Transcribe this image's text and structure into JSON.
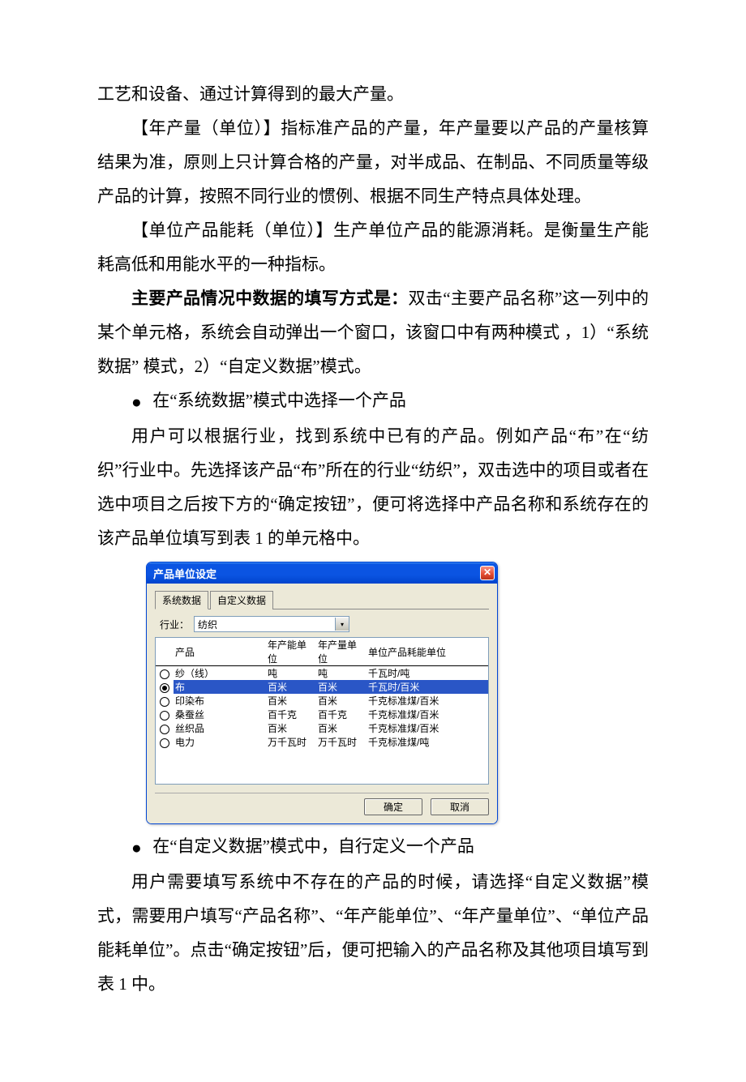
{
  "paragraphs": {
    "p1_text": "工艺和设备、通过计算得到的最大产量。",
    "p2_label": "【年产量（单位）】",
    "p2_text": "指标准产品的产量，年产量要以产品的产量核算结果为准，原则上只计算合格的产量，对半成品、在制品、不同质量等级产品的计算，按照不同行业的惯例、根据不同生产特点具体处理。",
    "p3_label": "【单位产品能耗（单位）】",
    "p3_text": "生产单位产品的能源消耗。是衡量生产能耗高低和用能水平的一种指标。",
    "p4_label": "主要产品情况中数据的填写方式是：",
    "p4_text": "双击“主要产品名称”这一列中的某个单元格，系统会自动弹出一个窗口，该窗口中有两种模式 ，1）“系统数据” 模式，2）“自定义数据”模式。",
    "bullet1_text": "在“系统数据”模式中选择一个产品",
    "p5_text": "用户可以根据行业，找到系统中已有的产品。例如产品“布”在“纺织”行业中。先选择该产品“布”所在的行业“纺织”，双击选中的项目或者在选中项目之后按下方的“确定按钮”，便可将选择中产品名称和系统存在的该产品单位填写到表 1 的单元格中。",
    "bullet2_text": "在“自定义数据”模式中，自行定义一个产品",
    "p6_text": "用户需要填写系统中不存在的产品的时候，请选择“自定义数据”模式，需要用户填写“产品名称”、“年产能单位”、“年产量单位”、“单位产品能耗单位”。点击“确定按钮”后，便可把输入的产品名称及其他项目填写到表 1 中。"
  },
  "dialog": {
    "title": "产品单位设定",
    "tabs": {
      "system": "系统数据",
      "custom": "自定义数据"
    },
    "industry": {
      "label": "行业：",
      "value": "纺织"
    },
    "columns": {
      "blank": "",
      "product": "产品",
      "cap_unit": "年产能单位",
      "out_unit": "年产量单位",
      "energy_unit": "单位产品耗能单位"
    },
    "rows": [
      {
        "name": "纱（线）",
        "cap": "吨",
        "out": "吨",
        "en": "千瓦时/吨",
        "selected": false
      },
      {
        "name": "布",
        "cap": "百米",
        "out": "百米",
        "en": "千瓦时/百米",
        "selected": true
      },
      {
        "name": "印染布",
        "cap": "百米",
        "out": "百米",
        "en": "千克标准煤/百米",
        "selected": false
      },
      {
        "name": "桑蚕丝",
        "cap": "百千克",
        "out": "百千克",
        "en": "千克标准煤/百米",
        "selected": false
      },
      {
        "name": "丝织品",
        "cap": "百米",
        "out": "百米",
        "en": "千克标准煤/百米",
        "selected": false
      },
      {
        "name": "电力",
        "cap": "万千瓦时",
        "out": "万千瓦时",
        "en": "千克标准煤/吨",
        "selected": false
      }
    ],
    "buttons": {
      "ok": "确定",
      "cancel": "取消"
    }
  }
}
